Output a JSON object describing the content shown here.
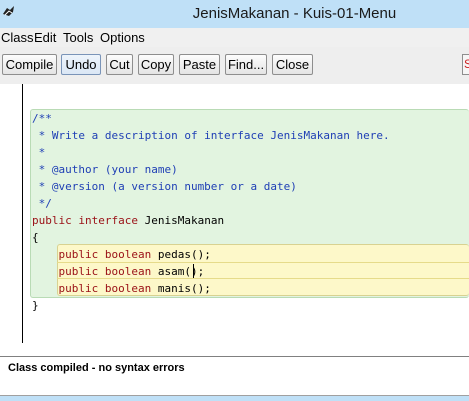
{
  "window": {
    "title": "JenisMakanan - Kuis-01-Menu"
  },
  "menu": {
    "items": [
      "Class",
      "Edit",
      "Tools",
      "Options"
    ]
  },
  "toolbar": {
    "buttons": [
      "Compile",
      "Undo",
      "Cut",
      "Copy",
      "Paste",
      "Find...",
      "Close"
    ],
    "active": "Undo",
    "clipped_label": "S"
  },
  "editor": {
    "lines": [
      "/**",
      " * Write a description of interface JenisMakanan here.",
      " *",
      " * @author (your name)",
      " * @version (a version number or a date)",
      " */",
      "public interface JenisMakanan",
      "{",
      "    public boolean pedas();",
      "    public boolean asam();",
      "    public boolean manis();",
      "}"
    ],
    "colors": {
      "comment": "#1f3fb5",
      "keyword": "#9a1016",
      "scope_outer": "#e2f4e0",
      "scope_inner": "#fdf8c9"
    }
  },
  "status": {
    "message": "Class compiled - no syntax errors"
  }
}
